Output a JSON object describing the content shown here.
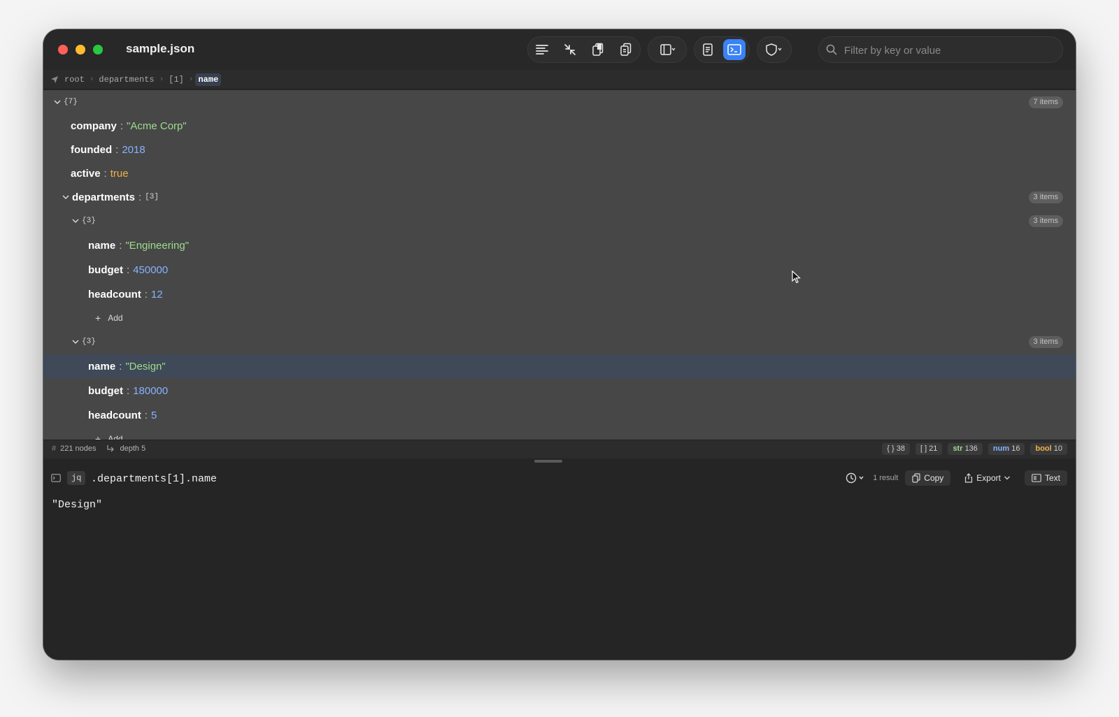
{
  "window": {
    "title": "sample.json"
  },
  "toolbar": {
    "icons": [
      "format-icon",
      "collapse-icon",
      "copy-json-icon",
      "copy-icon",
      "sidebar-icon",
      "document-icon",
      "terminal-icon",
      "shield-icon"
    ],
    "active_icon": "terminal-icon",
    "accent": "#3a82f6"
  },
  "search": {
    "placeholder": "Filter by key or value"
  },
  "breadcrumb": {
    "items": [
      "root",
      "departments",
      "[1]",
      "name"
    ],
    "current": "name"
  },
  "tree": {
    "root": {
      "brace": "{7}",
      "badge": "7 items"
    },
    "company": {
      "key": "company",
      "value": "\"Acme Corp\""
    },
    "founded": {
      "key": "founded",
      "value": "2018"
    },
    "active": {
      "key": "active",
      "value": "true"
    },
    "departments": {
      "key": "departments",
      "brace": "[3]",
      "badge": "3 items"
    },
    "dept0": {
      "brace": "{3}",
      "badge": "3 items",
      "name": {
        "key": "name",
        "value": "\"Engineering\""
      },
      "budget": {
        "key": "budget",
        "value": "450000"
      },
      "headcount": {
        "key": "headcount",
        "value": "12"
      },
      "add_label": "Add"
    },
    "dept1": {
      "brace": "{3}",
      "badge": "3 items",
      "name": {
        "key": "name",
        "value": "\"Design\""
      },
      "budget": {
        "key": "budget",
        "value": "180000"
      },
      "headcount": {
        "key": "headcount",
        "value": "5"
      },
      "add_label": "Add"
    },
    "colors": {
      "string": "#9ddc8c",
      "number": "#86b2ff",
      "bool": "#f0b04a"
    }
  },
  "status": {
    "nodes": "221 nodes",
    "depth": "depth 5",
    "counts": {
      "objects": "{ } 38",
      "arrays": "[ ] 21",
      "str_label": "str",
      "str_count": "136",
      "num_label": "num",
      "num_count": "16",
      "bool_label": "bool",
      "bool_count": "10"
    }
  },
  "query": {
    "mode": "jq",
    "value": ".departments[1].name",
    "result_count": "1 result",
    "copy_label": "Copy",
    "export_label": "Export",
    "format_label": "Text",
    "result": "\"Design\""
  }
}
